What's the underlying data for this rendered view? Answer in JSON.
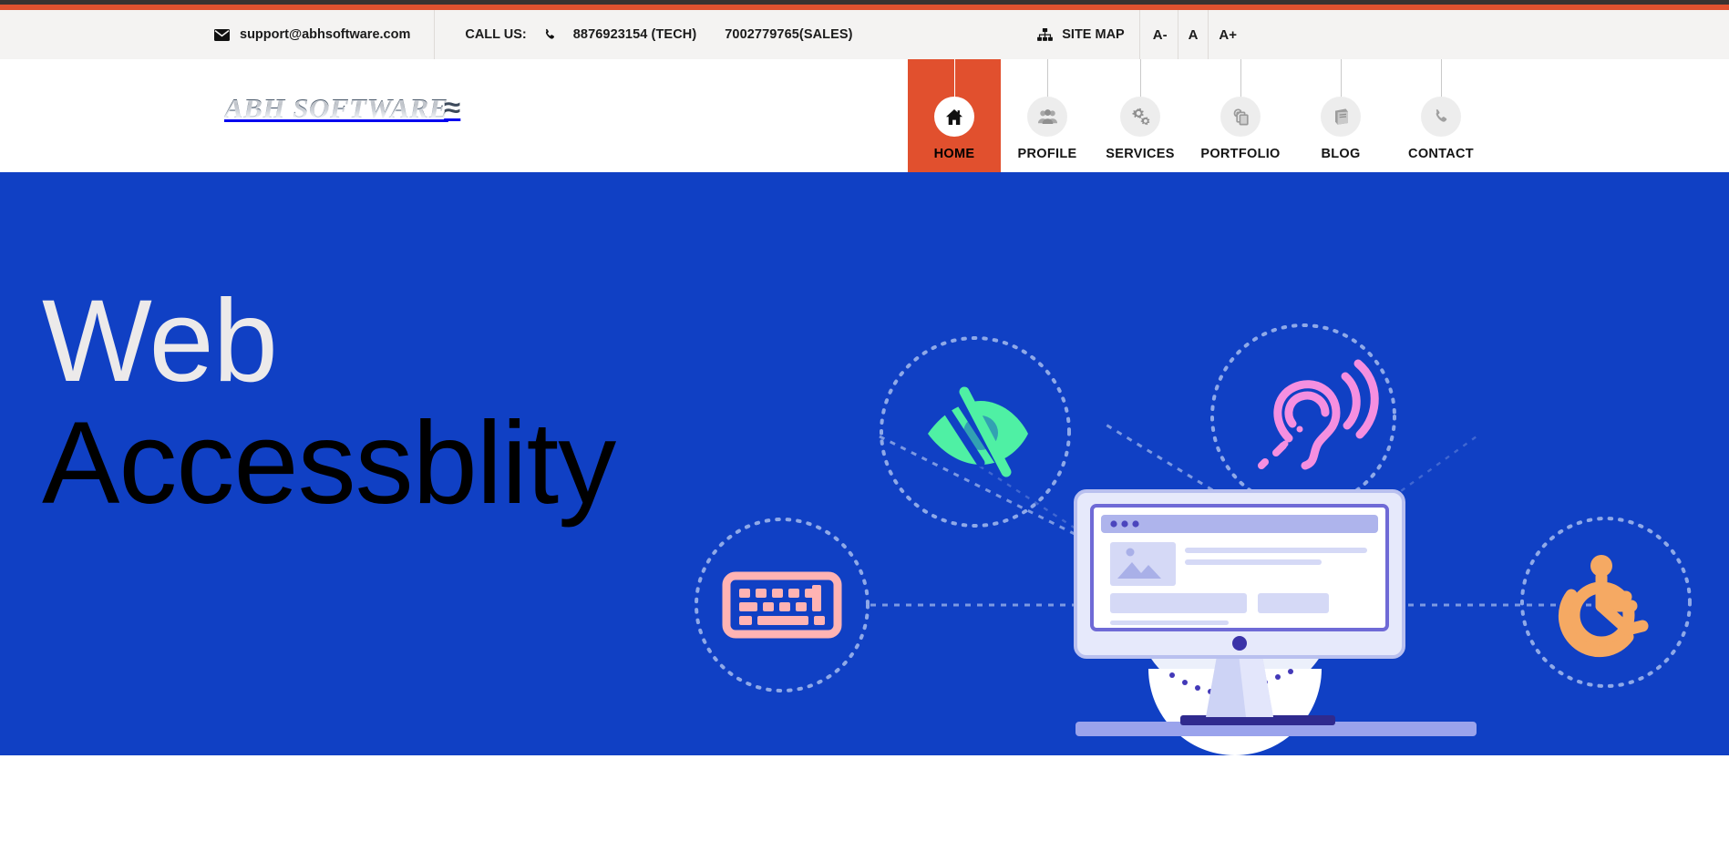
{
  "theme": {
    "accent_orange": "#e0522f",
    "active_tab_orange": "#e1502e",
    "dark_strip": "#3a3330",
    "hero_blue": "#1040c4",
    "utility_bg": "#f4f3f2"
  },
  "utility_bar": {
    "email_icon": "envelope-icon",
    "email": "support@abhsoftware.com",
    "call_label": "CALL US:",
    "phone_icon": "phone-icon",
    "phone_tech": "8876923154 (TECH)",
    "phone_sales": "7002779765(SALES)",
    "sitemap_icon": "sitemap-icon",
    "sitemap_label": "SITE MAP",
    "font_decrease": "A-",
    "font_normal": "A",
    "font_increase": "A+"
  },
  "brand": {
    "logo_text": "ABH SOFTWARE",
    "logo_mark": "≈"
  },
  "nav": {
    "items": [
      {
        "label": "HOME",
        "icon": "home-icon",
        "active": true
      },
      {
        "label": "PROFILE",
        "icon": "users-icon",
        "active": false
      },
      {
        "label": "SERVICES",
        "icon": "gears-icon",
        "active": false
      },
      {
        "label": "PORTFOLIO",
        "icon": "layers-icon",
        "active": false
      },
      {
        "label": "BLOG",
        "icon": "book-icon",
        "active": false
      },
      {
        "label": "CONTACT",
        "icon": "phone-icon",
        "active": false
      }
    ]
  },
  "hero": {
    "heading_line1": "Web",
    "heading_line2": "Accessblity",
    "illustration": {
      "name": "web-accessibility-illustration",
      "center": "desktop-monitor-with-webpage",
      "nodes": [
        {
          "name": "eye-slash-icon",
          "label": "visual impairment",
          "color": "#4ff0a4"
        },
        {
          "name": "ear-hearing-icon",
          "label": "hearing impairment",
          "color": "#f58fe0"
        },
        {
          "name": "keyboard-icon",
          "label": "keyboard navigation",
          "color": "#ffb3b3"
        },
        {
          "name": "wheelchair-icon",
          "label": "mobility impairment",
          "color": "#f5a963"
        }
      ]
    }
  }
}
